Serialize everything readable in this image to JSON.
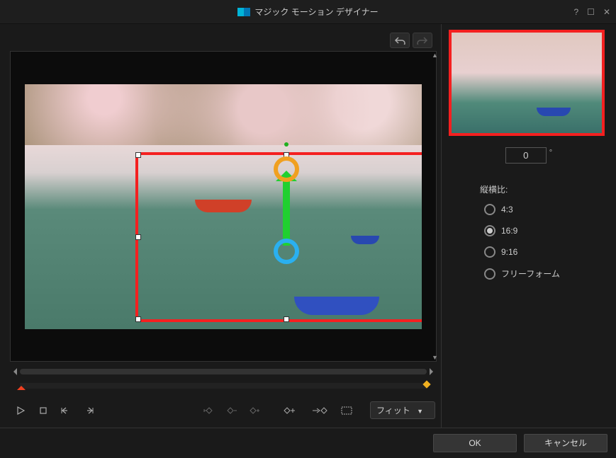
{
  "title": "マジック モーション デザイナー",
  "rotation": {
    "value": "0"
  },
  "aspect": {
    "label": "縦横比:",
    "options": [
      "4:3",
      "16:9",
      "9:16",
      "フリーフォーム"
    ],
    "selected": "16:9"
  },
  "fit": {
    "label": "フィット"
  },
  "footer": {
    "ok": "OK",
    "cancel": "キャンセル"
  }
}
